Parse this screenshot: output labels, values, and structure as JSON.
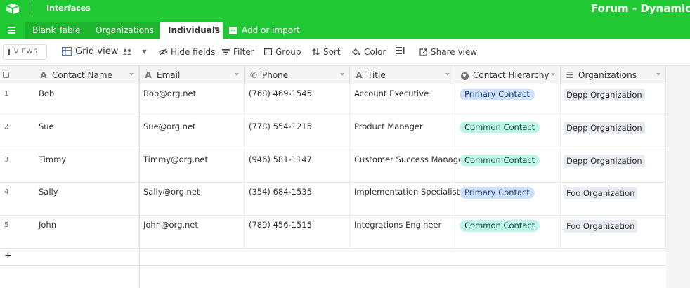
{
  "app": {
    "interfaces_label": "Interfaces",
    "base_title": "Forum - Dynamic Sin",
    "brand_color": "#20c933"
  },
  "tabs": [
    {
      "label": "Blank Table"
    },
    {
      "label": "Organizations"
    },
    {
      "label": "Individuals"
    }
  ],
  "add_import_label": "Add or import",
  "viewbar": {
    "views_label": "VIEWS",
    "grid_view_label": "Grid view",
    "hide_fields": "Hide fields",
    "filter": "Filter",
    "group": "Group",
    "sort": "Sort",
    "color": "Color",
    "share_view": "Share view"
  },
  "columns": [
    {
      "label": "Contact Name",
      "icon": "text-field-icon"
    },
    {
      "label": "Email",
      "icon": "text-field-icon"
    },
    {
      "label": "Phone",
      "icon": "phone-icon"
    },
    {
      "label": "Title",
      "icon": "text-field-icon"
    },
    {
      "label": "Contact Hierarchy",
      "icon": "single-select-icon"
    },
    {
      "label": "Organizations",
      "icon": "linked-record-icon"
    }
  ],
  "rows": [
    {
      "num": "1",
      "name": "Bob",
      "email": "Bob@org.net",
      "phone": "(768) 469-1545",
      "title": "Account Executive",
      "hierarchy": "Primary Contact",
      "org": "Depp Organization"
    },
    {
      "num": "2",
      "name": "Sue",
      "email": "Sue@org.net",
      "phone": "(778) 554-1215",
      "title": "Product Manager",
      "hierarchy": "Common Contact",
      "org": "Depp Organization"
    },
    {
      "num": "3",
      "name": "Timmy",
      "email": "Timmy@org.net",
      "phone": "(946) 581-1147",
      "title": "Customer Success Manager",
      "hierarchy": "Common Contact",
      "org": "Depp Organization"
    },
    {
      "num": "4",
      "name": "Sally",
      "email": "Sally@org.net",
      "phone": "(354) 684-1535",
      "title": "Implementation Specialist",
      "hierarchy": "Primary Contact",
      "org": "Foo Organization"
    },
    {
      "num": "5",
      "name": "John",
      "email": "John@org.net",
      "phone": "(789) 456-1515",
      "title": "Integrations Engineer",
      "hierarchy": "Common Contact",
      "org": "Foo Organization"
    }
  ],
  "add_row_label": "+"
}
